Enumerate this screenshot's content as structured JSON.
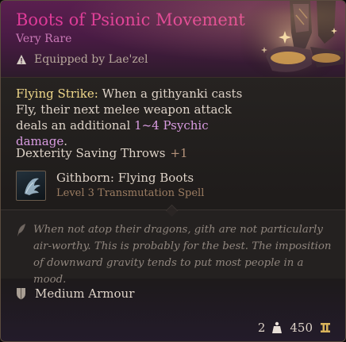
{
  "item": {
    "name": "Boots of Psionic Movement",
    "rarity": "Very Rare",
    "equipped_by": "Equipped by Lae'zel"
  },
  "description": {
    "strike_label": "Flying Strike:",
    "line1": "When a githyanki casts Fly,",
    "line2": "their next melee weapon attack deals an",
    "line3_prefix": "additional",
    "damage": "1~4 Psychic damage",
    "line3_suffix": "."
  },
  "saving_throw": {
    "label": "Dexterity Saving Throws",
    "bonus": "+1"
  },
  "spell": {
    "name": "Githborn: Flying Boots",
    "level": "Level 3 Transmutation Spell"
  },
  "flavor": {
    "text": "When not atop their dragons, gith are not particularly air-worthy. This is probably for the best. The imposition of downward gravity tends to put most people in a mood."
  },
  "armour": {
    "type": "Medium Armour"
  },
  "footer": {
    "weight": "2",
    "value": "450"
  },
  "icons": {
    "warning": "warning-icon",
    "spell": "flying-boots-spell-icon",
    "quill": "quill-icon",
    "armour": "shield-icon",
    "weight": "weight-icon",
    "gold": "gold-icon"
  },
  "colors": {
    "item_name": "#de3b98",
    "rarity": "#c978b6",
    "header_bg": "#5a1f4f",
    "body_text": "#ded3c8",
    "highlight": "#f0d88a",
    "damage": "#d99be1",
    "spell_level": "#9c7d62",
    "flavor_text": "#8f857d"
  }
}
